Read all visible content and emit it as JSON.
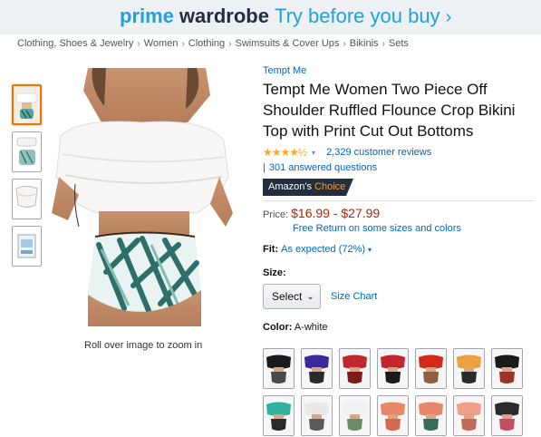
{
  "banner": {
    "prime": "prime",
    "wardrobe": "wardrobe",
    "try": "Try before you buy",
    "chevron": "›"
  },
  "breadcrumb": [
    "Clothing, Shoes & Jewelry",
    "Women",
    "Clothing",
    "Swimsuits & Cover Ups",
    "Bikinis",
    "Sets"
  ],
  "breadcrumb_sep": "›",
  "zoom_note": "Roll over image to zoom in",
  "product": {
    "brand": "Tempt Me",
    "title": "Tempt Me Women Two Piece Off Shoulder Ruffled Flounce Crop Bikini Top with Print Cut Out Bottoms",
    "stars": "★★★★½",
    "rating_caret": "▾",
    "reviews": "2,329 customer reviews",
    "answered_bar": "|",
    "answered": "301 answered questions",
    "choice_a": "Amazon's",
    "choice_b": "Choice",
    "price_label": "Price:",
    "price": "$16.99 - $27.99",
    "free_return": "Free Return on some sizes and colors",
    "fit_label": "Fit:",
    "fit_value": "As expected (72%)",
    "fit_caret": "▾",
    "size_label": "Size:",
    "size_select": "Select",
    "size_chevron": "⌄",
    "size_chart": "Size Chart",
    "color_label": "Color:",
    "color_value": "A-white"
  },
  "swatches": [
    {
      "top": "#1a1a1a",
      "bottom": "#4a4a4a"
    },
    {
      "top": "#3a2a9a",
      "bottom": "#2a2a2a"
    },
    {
      "top": "#c0282e",
      "bottom": "#7a1a1a"
    },
    {
      "top": "#c0282e",
      "bottom": "#1a1a1a"
    },
    {
      "top": "#d42a1c",
      "bottom": "#8a6040"
    },
    {
      "top": "#f0a040",
      "bottom": "#2a2a2a"
    },
    {
      "top": "#1a1a1a",
      "bottom": "#9a3030"
    },
    {
      "top": "#2fb39a",
      "bottom": "#2a2a2a"
    },
    {
      "top": "#e9e9e9",
      "bottom": "#5a5a5a"
    },
    {
      "top": "#f2f2f2",
      "bottom": "#6a8a6a"
    },
    {
      "top": "#e8866a",
      "bottom": "#d06a50"
    },
    {
      "top": "#e8866a",
      "bottom": "#3a6a5a"
    },
    {
      "top": "#f0a088",
      "bottom": "#c06a5a"
    },
    {
      "top": "#2a2a2a",
      "bottom": "#c05060"
    }
  ]
}
